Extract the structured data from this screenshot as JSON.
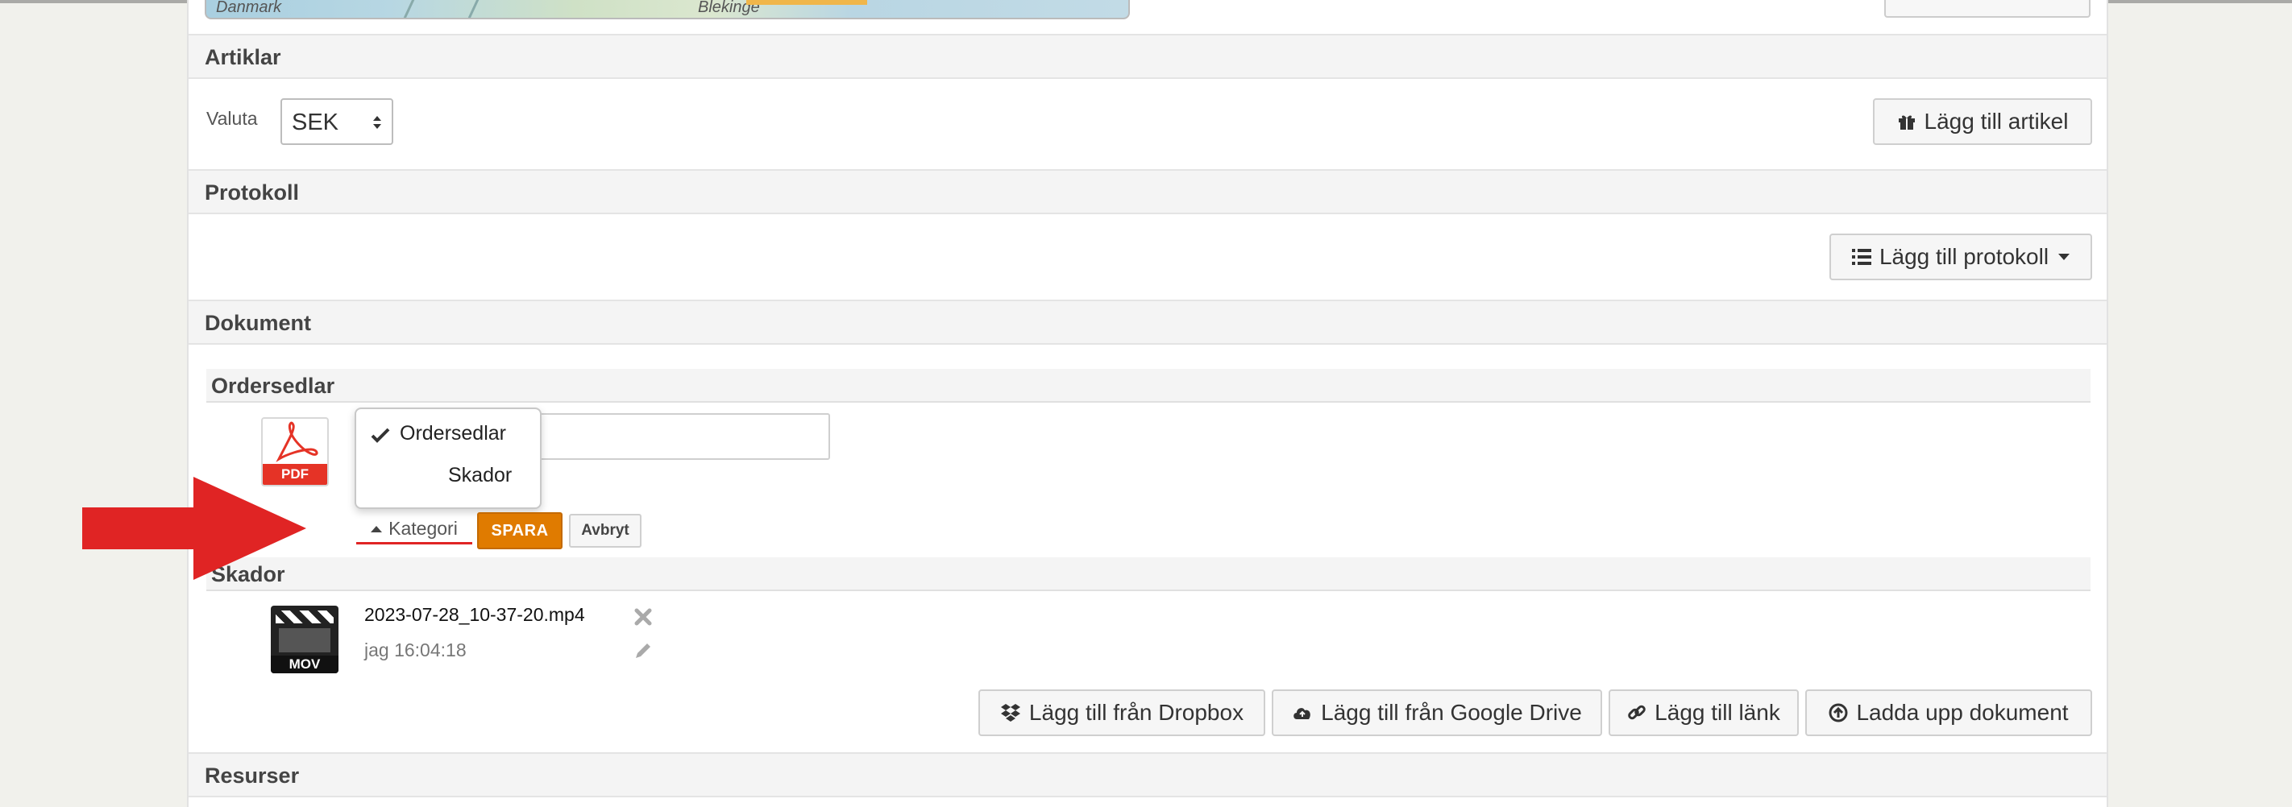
{
  "map": {
    "label_left": "Danmark",
    "label_mid": "Blekinge"
  },
  "sections": {
    "artiklar": "Artiklar",
    "protokoll": "Protokoll",
    "dokument": "Dokument",
    "resurser": "Resurser"
  },
  "artiklar": {
    "valuta_label": "Valuta",
    "valuta_value": "SEK",
    "add_button": "Lägg till artikel"
  },
  "protokoll": {
    "add_button": "Lägg till protokoll"
  },
  "dokument": {
    "ordersedlar_header": "Ordersedlar",
    "skador_header": "Skador",
    "pdf_badge": "PDF",
    "category_dropdown": {
      "options": [
        {
          "label": "Ordersedlar",
          "checked": true
        },
        {
          "label": "Skador",
          "checked": false
        }
      ]
    },
    "kategori_label": "Kategori",
    "spara_label": "SPARA",
    "avbryt_label": "Avbryt",
    "file": {
      "badge": "MOV",
      "name": "2023-07-28_10-37-20.mp4",
      "meta": "jag 16:04:18"
    },
    "buttons": {
      "dropbox": "Lägg till från Dropbox",
      "google_drive": "Lägg till från Google Drive",
      "link": "Lägg till länk",
      "upload": "Ladda upp dokument"
    }
  },
  "colors": {
    "accent_orange": "#e07b00",
    "arrow_red": "#e02424",
    "pdf_red": "#e53326"
  }
}
